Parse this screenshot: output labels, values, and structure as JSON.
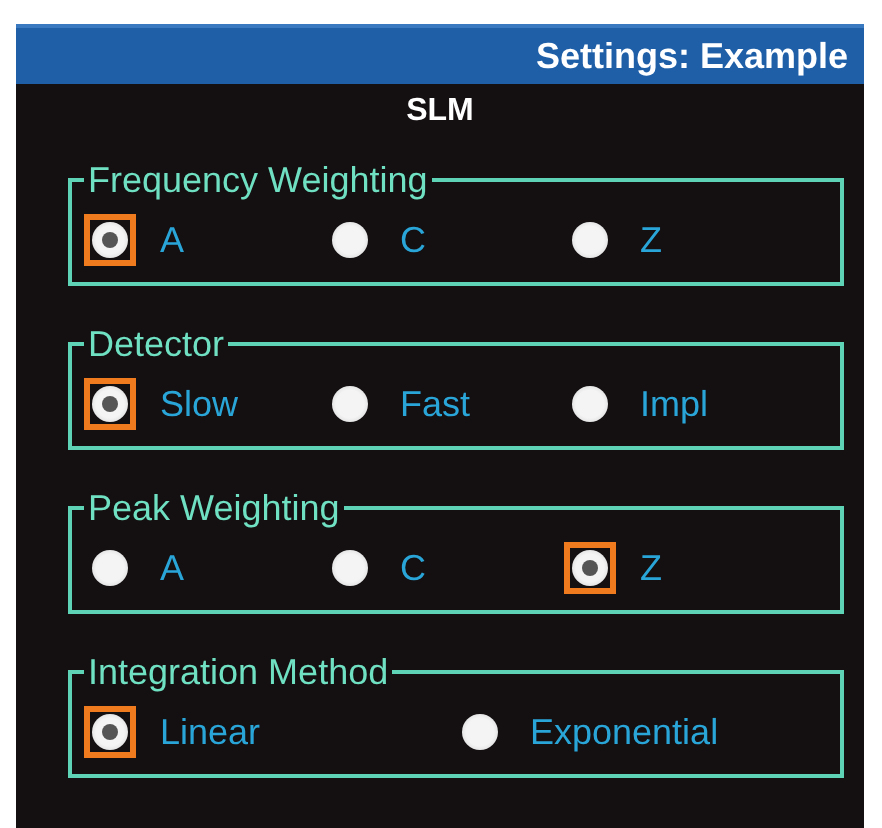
{
  "window": {
    "title": "Settings: Example"
  },
  "section_title": "SLM",
  "groups": [
    {
      "label": "Frequency Weighting",
      "options": [
        {
          "label": "A",
          "selected": true
        },
        {
          "label": "C",
          "selected": false
        },
        {
          "label": "Z",
          "selected": false
        }
      ]
    },
    {
      "label": "Detector",
      "options": [
        {
          "label": "Slow",
          "selected": true
        },
        {
          "label": "Fast",
          "selected": false
        },
        {
          "label": "Impl",
          "selected": false
        }
      ]
    },
    {
      "label": "Peak Weighting",
      "options": [
        {
          "label": "A",
          "selected": false
        },
        {
          "label": "C",
          "selected": false
        },
        {
          "label": "Z",
          "selected": true
        }
      ]
    },
    {
      "label": "Integration Method",
      "options": [
        {
          "label": "Linear",
          "selected": true
        },
        {
          "label": "Exponential",
          "selected": false
        }
      ]
    }
  ]
}
